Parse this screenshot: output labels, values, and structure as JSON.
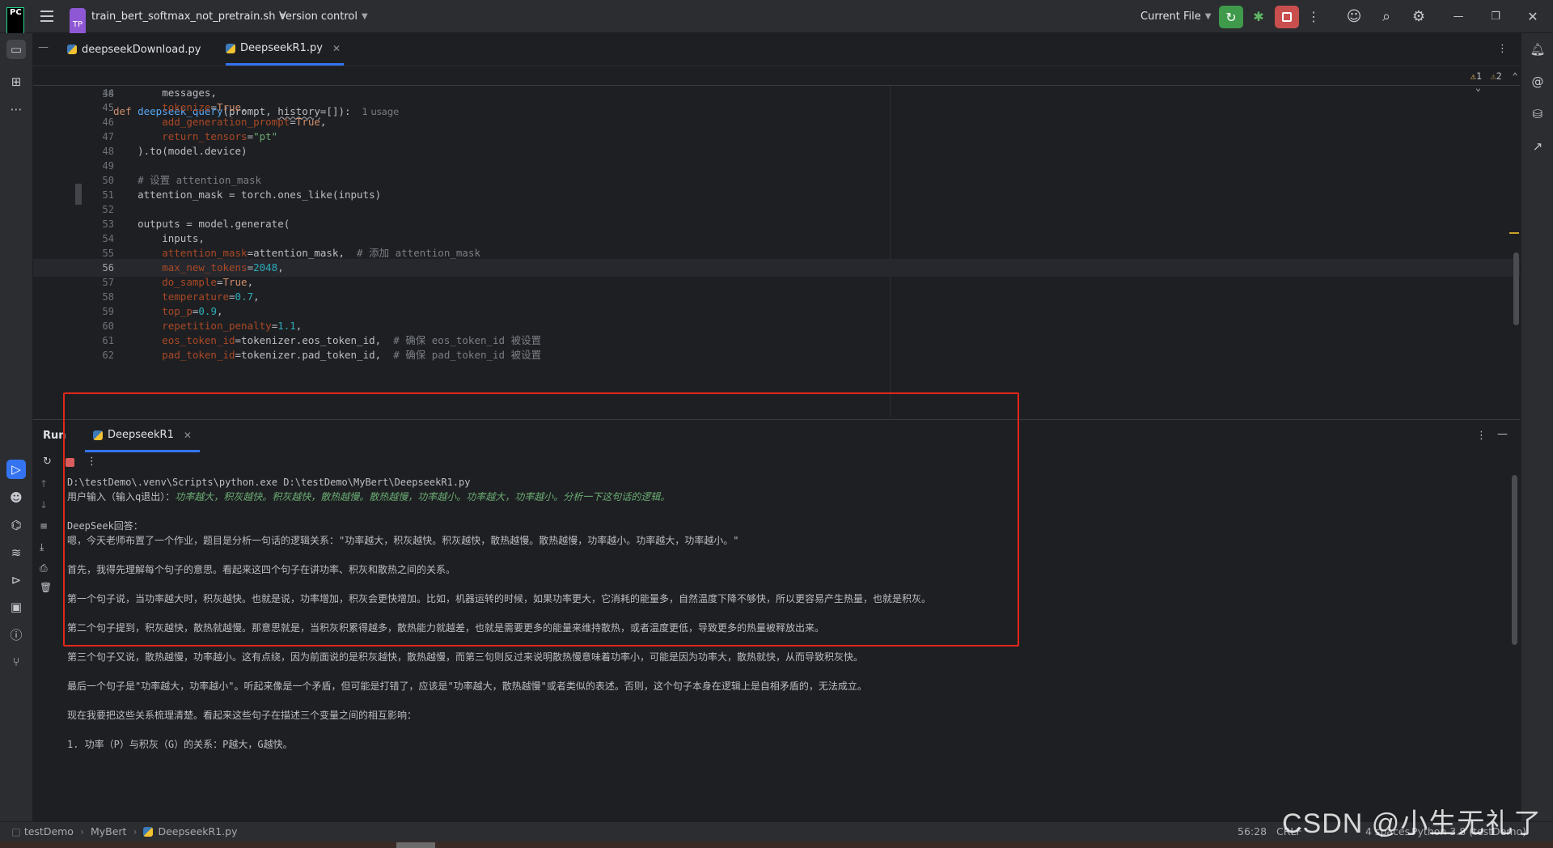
{
  "titlebar": {
    "app_logo": "PC",
    "project_badge": "TP",
    "project_name": "train_bert_softmax_not_pretrain.sh",
    "version_control": "Version control",
    "run_config": "Current File"
  },
  "editor_tabs": [
    {
      "label": "deepseekDownload.py",
      "active": false
    },
    {
      "label": "DeepseekR1.py",
      "active": true
    }
  ],
  "inspections": {
    "warnings": "1",
    "weak_warnings": "2"
  },
  "editor": {
    "sticky_line": {
      "num": "38",
      "usage": "1 usage"
    },
    "line_numbers": [
      "44",
      "45",
      "46",
      "47",
      "48",
      "49",
      "50",
      "51",
      "52",
      "53",
      "54",
      "55",
      "56",
      "57",
      "58",
      "59",
      "60",
      "61",
      "62"
    ],
    "current_line": "56"
  },
  "run": {
    "title": "Run",
    "tab": "DeepseekR1",
    "console_lines": [
      "D:\\testDemo\\.venv\\Scripts\\python.exe D:\\testDemo\\MyBert\\DeepseekR1.py",
      "用户输入（输入q退出）：",
      "功率越大，积灰越快。积灰越快，散热越慢。散热越慢，功率越小。功率越大，功率越小。分析一下这句话的逻辑。",
      "",
      "DeepSeek回答：",
      "嗯，今天老师布置了一个作业，题目是分析一句话的逻辑关系：\"功率越大，积灰越快。积灰越快，散热越慢。散热越慢，功率越小。功率越大，功率越小。\"",
      "",
      "首先，我得先理解每个句子的意思。看起来这四个句子在讲功率、积灰和散热之间的关系。",
      "",
      "第一个句子说，当功率越大时，积灰越快。也就是说，功率增加，积灰会更快增加。比如，机器运转的时候，如果功率更大，它消耗的能量多，自然温度下降不够快，所以更容易产生热量，也就是积灰。",
      "",
      "第二个句子提到，积灰越快，散热就越慢。那意思就是，当积灰积累得越多，散热能力就越差，也就是需要更多的能量来维持散热，或者温度更低，导致更多的热量被释放出来。",
      "",
      "第三个句子又说，散热越慢，功率越小。这有点绕，因为前面说的是积灰越快，散热越慢，而第三句则反过来说明散热慢意味着功率小，可能是因为功率大，散热就快，从而导致积灰快。",
      "",
      "最后一个句子是\"功率越大，功率越小\"。听起来像是一个矛盾，但可能是打错了，应该是\"功率越大，散热越慢\"或者类似的表述。否则，这个句子本身在逻辑上是自相矛盾的，无法成立。",
      "",
      "现在我要把这些关系梳理清楚。看起来这些句子在描述三个变量之间的相互影响：",
      "",
      "1. 功率（P）与积灰（G）的关系：P越大，G越快。"
    ]
  },
  "statusbar": {
    "crumbs": [
      "testDemo",
      "MyBert",
      "DeepseekR1.py"
    ],
    "position": "56:28",
    "encoding": "CRLF",
    "indent": "4 spaces",
    "interpreter": "Python 3.8 (testDemo)"
  },
  "watermark": "CSDN @小生无礼了",
  "colors": {
    "accent": "#3574f0",
    "run_green": "#3f9a4c",
    "stop_red": "#c94f4f",
    "highlight": "#e2271a"
  }
}
